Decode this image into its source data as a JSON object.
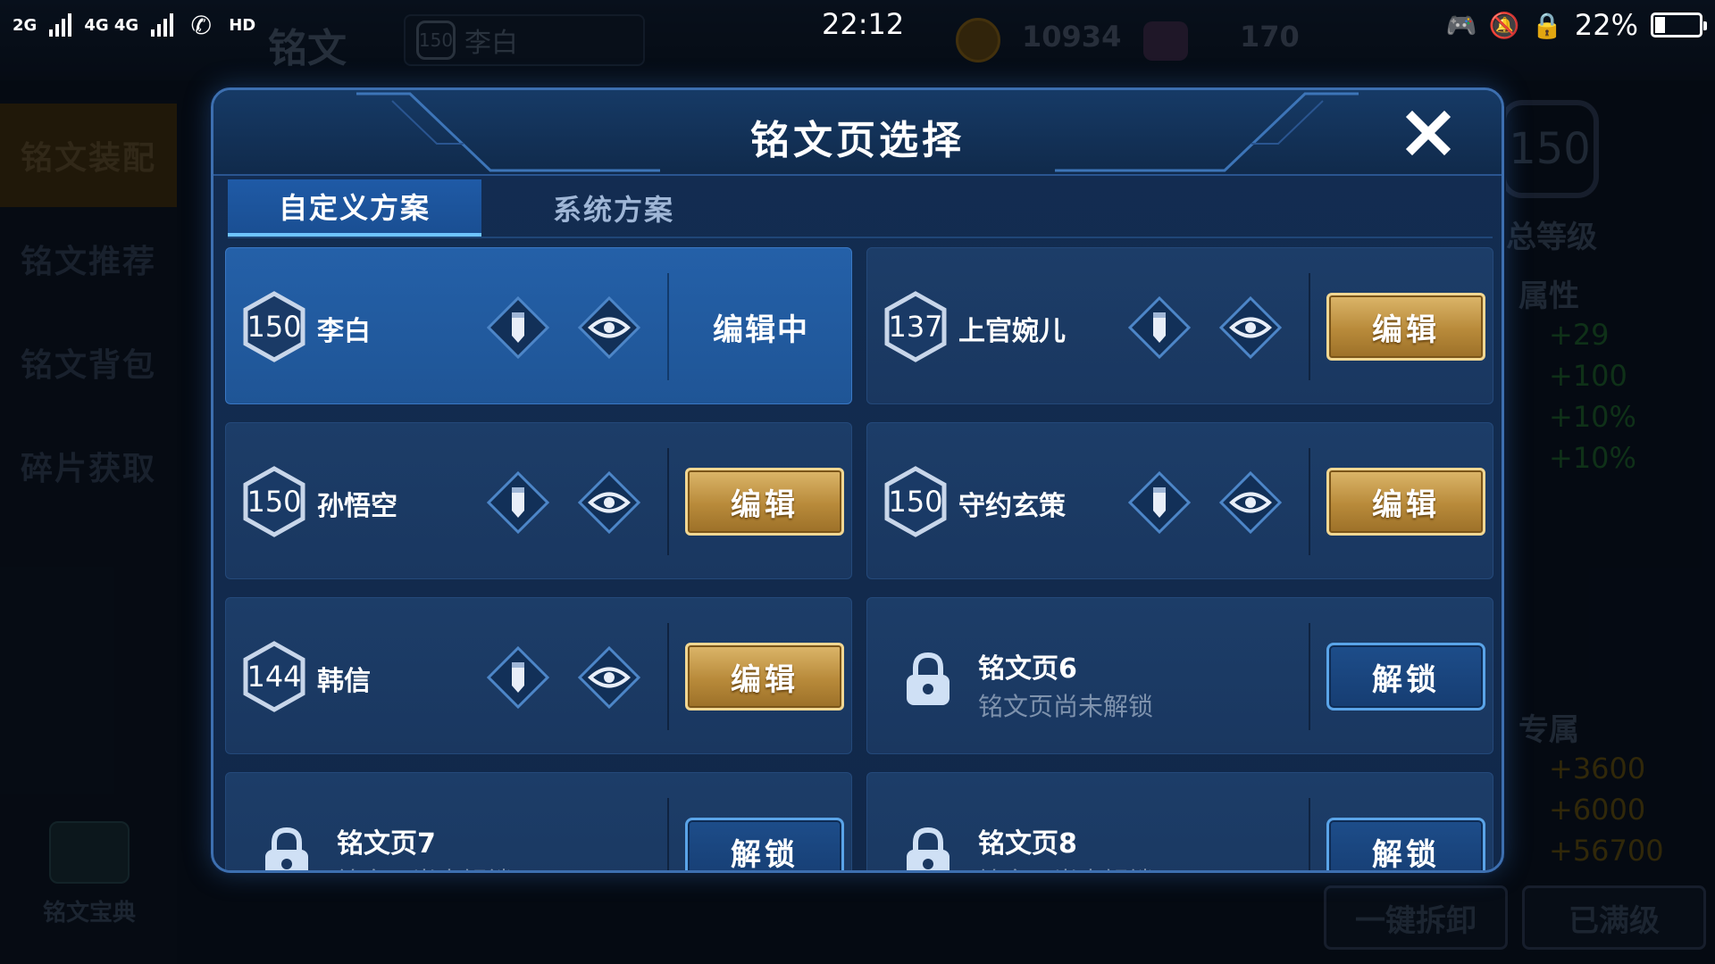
{
  "status_bar": {
    "network_left": "2G",
    "network_right": "4G 4G",
    "hd": "HD",
    "time": "22:12",
    "battery": "22%",
    "battery_level": 0.22
  },
  "background": {
    "page_title": "铭文",
    "hero_chip": {
      "level": "150",
      "name": "李白"
    },
    "gold": "10934",
    "gems": "170",
    "sidebar": [
      "铭文装配",
      "铭文推荐",
      "铭文背包",
      "碎片获取"
    ],
    "codex_label": "铭文宝典",
    "right_level": "150",
    "right_labels": {
      "total_level": "总等级",
      "attributes": "属性",
      "exclusive": "专属"
    },
    "stats_green": [
      "+29",
      "+100",
      "+10%",
      "+10%"
    ],
    "stats_gold": [
      "+3600",
      "+6000",
      "+56700"
    ],
    "btn_unequip_all": "一键拆卸",
    "btn_max_level": "已满级"
  },
  "modal": {
    "title": "铭文页选择",
    "tabs": [
      {
        "label": "自定义方案",
        "active": true
      },
      {
        "label": "系统方案",
        "active": false
      }
    ],
    "pages": [
      {
        "level": "150",
        "name": "李白",
        "state": "editing",
        "action": "编辑中"
      },
      {
        "level": "137",
        "name": "上官婉儿",
        "state": "ready",
        "action": "编辑"
      },
      {
        "level": "150",
        "name": "孙悟空",
        "state": "ready",
        "action": "编辑"
      },
      {
        "level": "150",
        "name": "守约玄策",
        "state": "ready",
        "action": "编辑"
      },
      {
        "level": "144",
        "name": "韩信",
        "state": "ready",
        "action": "编辑"
      },
      {
        "name": "铭文页6",
        "subtitle": "铭文页尚未解锁",
        "state": "locked",
        "action": "解锁"
      },
      {
        "name": "铭文页7",
        "subtitle": "铭文页尚未解锁",
        "state": "locked",
        "action": "解锁"
      },
      {
        "name": "铭文页8",
        "subtitle": "铭文页尚未解锁",
        "state": "locked",
        "action": "解锁"
      }
    ]
  },
  "colors": {
    "gold_button": "#c89a48",
    "blue_button_border": "#5aa4e8",
    "modal_border": "#3d6fb0",
    "editing_card": "#2460a8"
  },
  "icons": [
    "close-icon",
    "pencil-icon",
    "eye-icon",
    "lock-icon",
    "level-hexagon-icon"
  ]
}
